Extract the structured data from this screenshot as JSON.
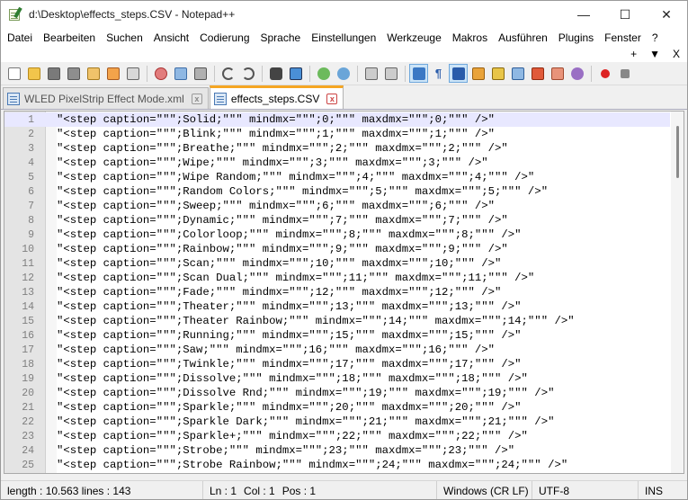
{
  "window": {
    "title": "d:\\Desktop\\effects_steps.CSV - Notepad++",
    "controls": {
      "minimize": "—",
      "maximize": "☐",
      "close": "✕"
    }
  },
  "menu": {
    "items": [
      "Datei",
      "Bearbeiten",
      "Suchen",
      "Ansicht",
      "Codierung",
      "Sprache",
      "Einstellungen",
      "Werkzeuge",
      "Makros",
      "Ausführen",
      "Plugins",
      "Fenster",
      "?"
    ],
    "right": {
      "plus": "+",
      "arrow": "▼",
      "close": "X"
    }
  },
  "toolbar": {
    "icons": [
      "new-file-icon",
      "open-file-icon",
      "save-icon",
      "save-all-icon",
      "close-icon",
      "close-all-icon",
      "print-icon",
      "cut-icon",
      "copy-icon",
      "paste-icon",
      "undo-icon",
      "redo-icon",
      "find-icon",
      "replace-icon",
      "zoom-in-icon",
      "zoom-out-icon",
      "sync-vertical-icon",
      "sync-horizontal-icon",
      "word-wrap-icon",
      "show-all-chars-icon",
      "indent-guide-icon",
      "doc-map-icon",
      "function-list-icon",
      "folder-workspace-icon",
      "monitor-icon",
      "record-macro-icon",
      "stop-macro-icon"
    ]
  },
  "tabs": [
    {
      "label": "WLED PixelStrip Effect Mode.xml",
      "active": false
    },
    {
      "label": "effects_steps.CSV",
      "active": true
    }
  ],
  "editor": {
    "lines": [
      {
        "n": "1",
        "text": "\"<step caption=\"\"\";Solid;\"\"\" mindmx=\"\"\";0;\"\"\" maxdmx=\"\"\";0;\"\"\" />\""
      },
      {
        "n": "2",
        "text": "\"<step caption=\"\"\";Blink;\"\"\" mindmx=\"\"\";1;\"\"\" maxdmx=\"\"\";1;\"\"\" />\""
      },
      {
        "n": "3",
        "text": "\"<step caption=\"\"\";Breathe;\"\"\" mindmx=\"\"\";2;\"\"\" maxdmx=\"\"\";2;\"\"\" />\""
      },
      {
        "n": "4",
        "text": "\"<step caption=\"\"\";Wipe;\"\"\" mindmx=\"\"\";3;\"\"\" maxdmx=\"\"\";3;\"\"\" />\""
      },
      {
        "n": "5",
        "text": "\"<step caption=\"\"\";Wipe Random;\"\"\" mindmx=\"\"\";4;\"\"\" maxdmx=\"\"\";4;\"\"\" />\""
      },
      {
        "n": "6",
        "text": "\"<step caption=\"\"\";Random Colors;\"\"\" mindmx=\"\"\";5;\"\"\" maxdmx=\"\"\";5;\"\"\" />\""
      },
      {
        "n": "7",
        "text": "\"<step caption=\"\"\";Sweep;\"\"\" mindmx=\"\"\";6;\"\"\" maxdmx=\"\"\";6;\"\"\" />\""
      },
      {
        "n": "8",
        "text": "\"<step caption=\"\"\";Dynamic;\"\"\" mindmx=\"\"\";7;\"\"\" maxdmx=\"\"\";7;\"\"\" />\""
      },
      {
        "n": "9",
        "text": "\"<step caption=\"\"\";Colorloop;\"\"\" mindmx=\"\"\";8;\"\"\" maxdmx=\"\"\";8;\"\"\" />\""
      },
      {
        "n": "10",
        "text": "\"<step caption=\"\"\";Rainbow;\"\"\" mindmx=\"\"\";9;\"\"\" maxdmx=\"\"\";9;\"\"\" />\""
      },
      {
        "n": "11",
        "text": "\"<step caption=\"\"\";Scan;\"\"\" mindmx=\"\"\";10;\"\"\" maxdmx=\"\"\";10;\"\"\" />\""
      },
      {
        "n": "12",
        "text": "\"<step caption=\"\"\";Scan Dual;\"\"\" mindmx=\"\"\";11;\"\"\" maxdmx=\"\"\";11;\"\"\" />\""
      },
      {
        "n": "13",
        "text": "\"<step caption=\"\"\";Fade;\"\"\" mindmx=\"\"\";12;\"\"\" maxdmx=\"\"\";12;\"\"\" />\""
      },
      {
        "n": "14",
        "text": "\"<step caption=\"\"\";Theater;\"\"\" mindmx=\"\"\";13;\"\"\" maxdmx=\"\"\";13;\"\"\" />\""
      },
      {
        "n": "15",
        "text": "\"<step caption=\"\"\";Theater Rainbow;\"\"\" mindmx=\"\"\";14;\"\"\" maxdmx=\"\"\";14;\"\"\" />\""
      },
      {
        "n": "16",
        "text": "\"<step caption=\"\"\";Running;\"\"\" mindmx=\"\"\";15;\"\"\" maxdmx=\"\"\";15;\"\"\" />\""
      },
      {
        "n": "17",
        "text": "\"<step caption=\"\"\";Saw;\"\"\" mindmx=\"\"\";16;\"\"\" maxdmx=\"\"\";16;\"\"\" />\""
      },
      {
        "n": "18",
        "text": "\"<step caption=\"\"\";Twinkle;\"\"\" mindmx=\"\"\";17;\"\"\" maxdmx=\"\"\";17;\"\"\" />\""
      },
      {
        "n": "19",
        "text": "\"<step caption=\"\"\";Dissolve;\"\"\" mindmx=\"\"\";18;\"\"\" maxdmx=\"\"\";18;\"\"\" />\""
      },
      {
        "n": "20",
        "text": "\"<step caption=\"\"\";Dissolve Rnd;\"\"\" mindmx=\"\"\";19;\"\"\" maxdmx=\"\"\";19;\"\"\" />\""
      },
      {
        "n": "21",
        "text": "\"<step caption=\"\"\";Sparkle;\"\"\" mindmx=\"\"\";20;\"\"\" maxdmx=\"\"\";20;\"\"\" />\""
      },
      {
        "n": "22",
        "text": "\"<step caption=\"\"\";Sparkle Dark;\"\"\" mindmx=\"\"\";21;\"\"\" maxdmx=\"\"\";21;\"\"\" />\""
      },
      {
        "n": "23",
        "text": "\"<step caption=\"\"\";Sparkle+;\"\"\" mindmx=\"\"\";22;\"\"\" maxdmx=\"\"\";22;\"\"\" />\""
      },
      {
        "n": "24",
        "text": "\"<step caption=\"\"\";Strobe;\"\"\" mindmx=\"\"\";23;\"\"\" maxdmx=\"\"\";23;\"\"\" />\""
      },
      {
        "n": "25",
        "text": "\"<step caption=\"\"\";Strobe Rainbow;\"\"\" mindmx=\"\"\";24;\"\"\" maxdmx=\"\"\";24;\"\"\" />\""
      }
    ],
    "current_line": 1
  },
  "status": {
    "length": "length : 10.563    lines : 143",
    "position_ln": "Ln : 1",
    "position_col": "Col : 1",
    "position_pos": "Pos : 1",
    "eol": "Windows (CR LF)",
    "encoding": "UTF-8",
    "mode": "INS"
  },
  "colors": {
    "current_line_bg": "#e8e8ff",
    "active_tab_accent": "#f5a623",
    "gutter_bg": "#e4e4e4"
  }
}
